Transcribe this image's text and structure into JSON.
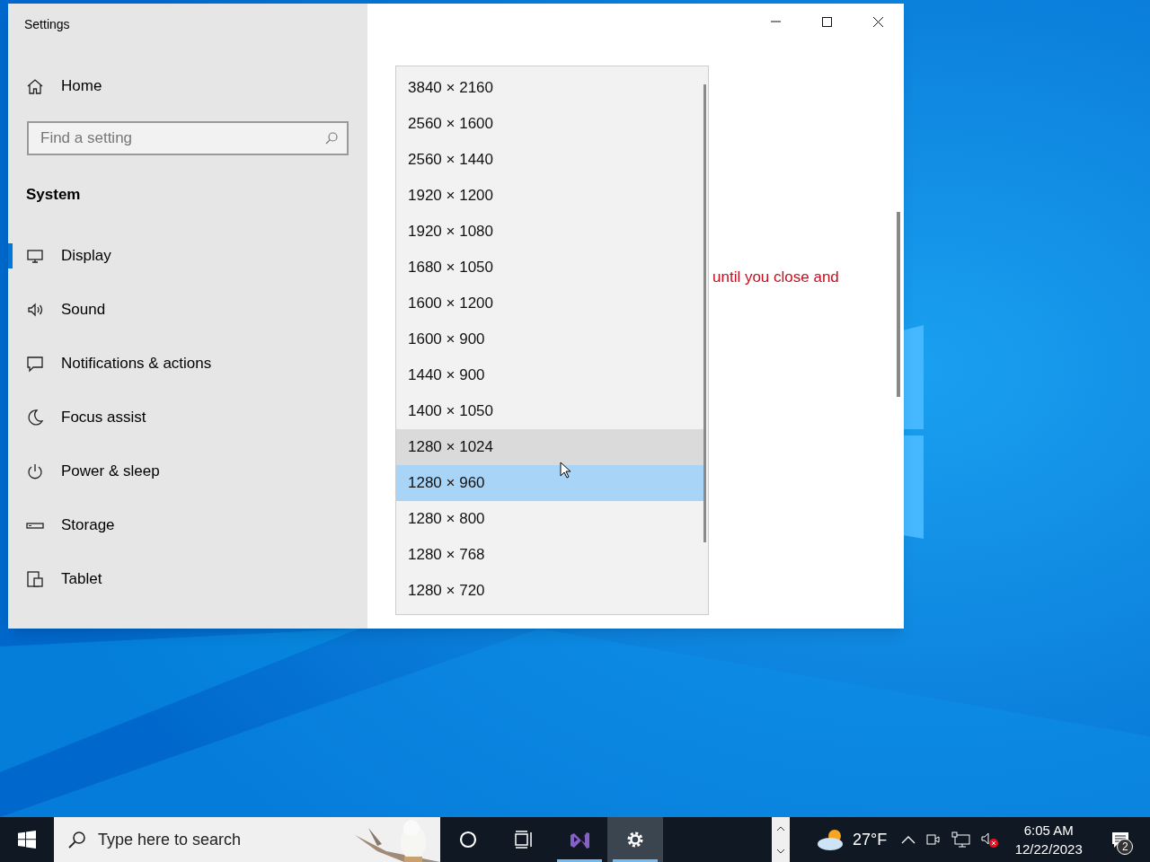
{
  "window": {
    "title": "Settings"
  },
  "sidebar": {
    "home": "Home",
    "search": {
      "placeholder": "Find a setting"
    },
    "section": "System",
    "items": [
      {
        "label": "Display",
        "selected": true
      },
      {
        "label": "Sound",
        "selected": false
      },
      {
        "label": "Notifications & actions",
        "selected": false
      },
      {
        "label": "Focus assist",
        "selected": false
      },
      {
        "label": "Power & sleep",
        "selected": false
      },
      {
        "label": "Storage",
        "selected": false
      },
      {
        "label": "Tablet",
        "selected": false
      }
    ]
  },
  "content": {
    "warning": "until you close and"
  },
  "resolution_list": [
    {
      "label": "3840 × 2160",
      "selected": false,
      "hovered": false
    },
    {
      "label": "2560 × 1600",
      "selected": false,
      "hovered": false
    },
    {
      "label": "2560 × 1440",
      "selected": false,
      "hovered": false
    },
    {
      "label": "1920 × 1200",
      "selected": false,
      "hovered": false
    },
    {
      "label": "1920 × 1080",
      "selected": false,
      "hovered": false
    },
    {
      "label": "1680 × 1050",
      "selected": false,
      "hovered": false
    },
    {
      "label": "1600 × 1200",
      "selected": false,
      "hovered": false
    },
    {
      "label": "1600 × 900",
      "selected": false,
      "hovered": false
    },
    {
      "label": "1440 × 900",
      "selected": false,
      "hovered": false
    },
    {
      "label": "1400 × 1050",
      "selected": false,
      "hovered": false
    },
    {
      "label": "1280 × 1024",
      "selected": false,
      "hovered": true
    },
    {
      "label": "1280 × 960",
      "selected": true,
      "hovered": false
    },
    {
      "label": "1280 × 800",
      "selected": false,
      "hovered": false
    },
    {
      "label": "1280 × 768",
      "selected": false,
      "hovered": false
    },
    {
      "label": "1280 × 720",
      "selected": false,
      "hovered": false
    }
  ],
  "taskbar": {
    "search_placeholder": "Type here to search",
    "apps": [
      {
        "active": false,
        "running": false
      },
      {
        "active": false,
        "running": false
      },
      {
        "active": false,
        "running": true
      },
      {
        "active": true,
        "running": true
      }
    ],
    "weather": "27°F",
    "time": "6:05 AM",
    "date": "12/22/2023",
    "notification_count": "2"
  }
}
